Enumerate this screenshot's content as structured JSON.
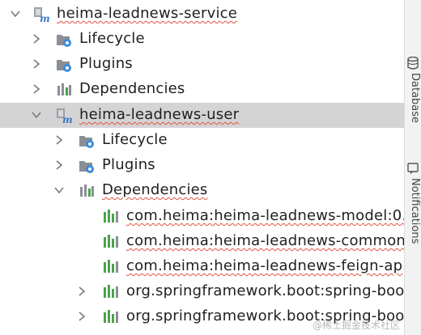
{
  "tree": {
    "project": {
      "label": "heima-leadnews-service",
      "icon": "maven-module-icon"
    },
    "children": [
      {
        "label": "Lifecycle",
        "icon": "lifecycle-folder-icon",
        "state": "collapsed"
      },
      {
        "label": "Plugins",
        "icon": "plugins-folder-icon",
        "state": "collapsed"
      },
      {
        "label": "Dependencies",
        "icon": "dependencies-icon",
        "state": "collapsed"
      }
    ],
    "module": {
      "label": "heima-leadnews-user",
      "icon": "maven-module-icon",
      "state": "expanded",
      "selected": true,
      "children": [
        {
          "label": "Lifecycle",
          "icon": "lifecycle-folder-icon",
          "state": "collapsed"
        },
        {
          "label": "Plugins",
          "icon": "plugins-folder-icon",
          "state": "collapsed"
        },
        {
          "label": "Dependencies",
          "icon": "dependencies-icon",
          "state": "expanded"
        }
      ],
      "dependencies": [
        {
          "label": "com.heima:heima-leadnews-model:0.",
          "icon": "library-icon",
          "expandable": false
        },
        {
          "label": "com.heima:heima-leadnews-common",
          "icon": "library-icon",
          "expandable": false
        },
        {
          "label": "com.heima:heima-leadnews-feign-ap",
          "icon": "library-icon",
          "expandable": false
        },
        {
          "label": "org.springframework.boot:spring-boot",
          "icon": "library-icon",
          "expandable": true
        },
        {
          "label": "org.springframework.boot:spring-boot",
          "icon": "library-icon",
          "expandable": true
        }
      ]
    }
  },
  "side_panel": {
    "tabs": [
      {
        "label": "Database",
        "icon": "database-icon"
      },
      {
        "label": "Notifications",
        "icon": "notifications-icon"
      }
    ]
  },
  "watermark": "@稀土掘金技术社区",
  "colors": {
    "selection": "#d4d4d4",
    "maven_blue": "#3a77c9",
    "gear_blue": "#3d8bd8",
    "folder_gray": "#8a8f96",
    "library_green": "#4aa34a",
    "spellcheck": "#e2523f"
  }
}
